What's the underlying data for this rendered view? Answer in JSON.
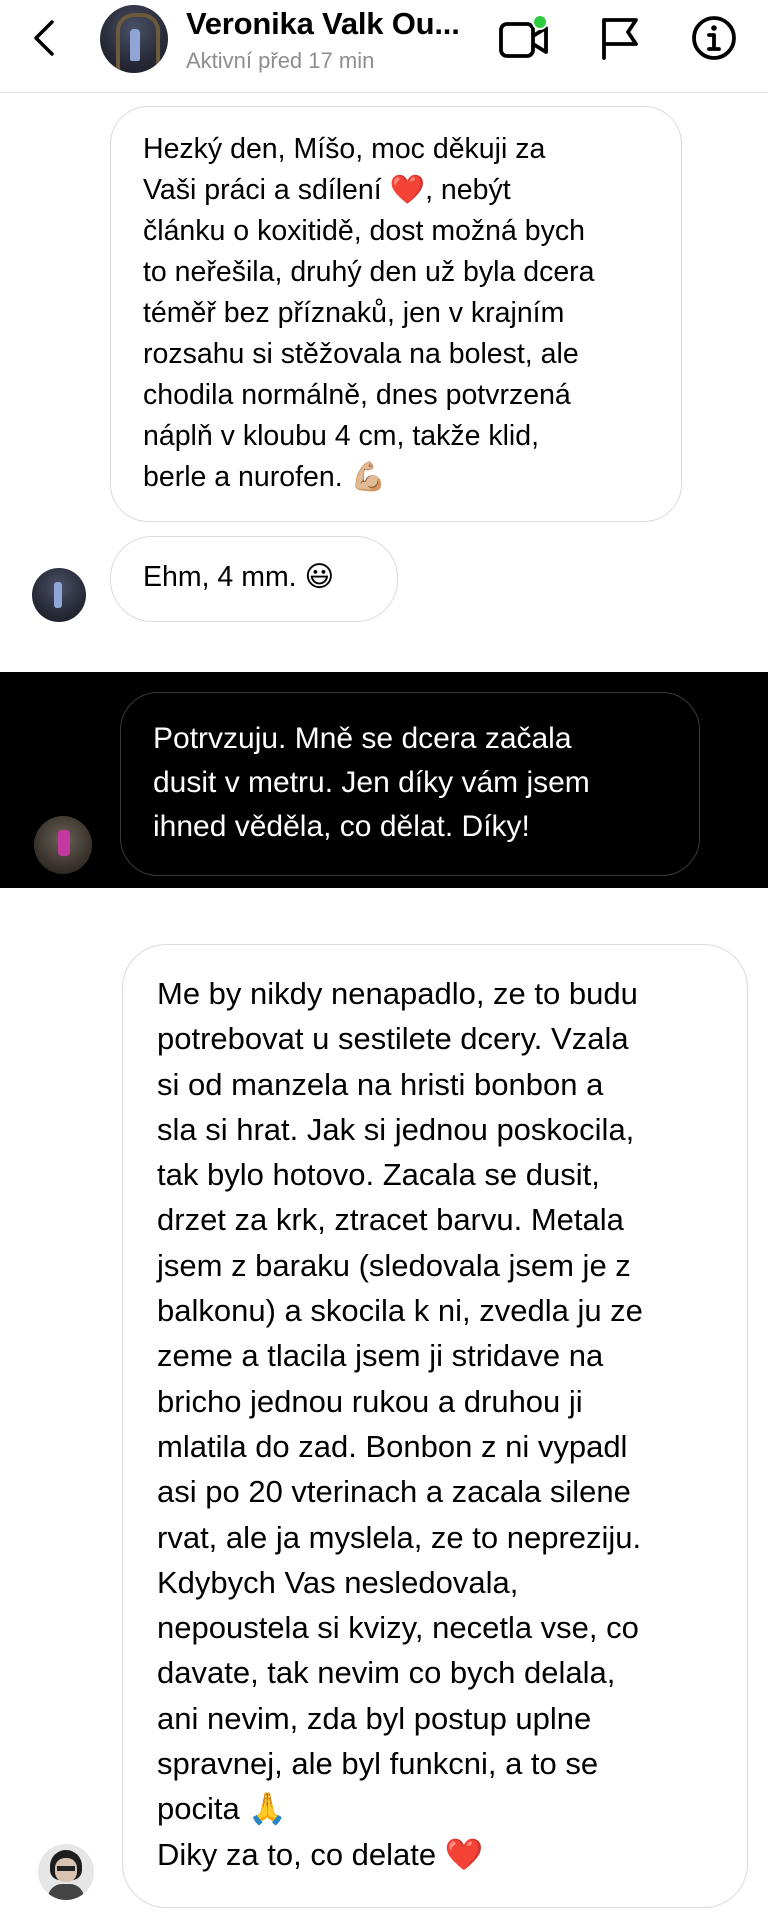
{
  "header": {
    "contact_name": "Veronika Valk Ou...",
    "status": "Aktivní před 17 min",
    "icons": [
      "back-chevron-icon",
      "video-call-icon",
      "flag-icon",
      "info-icon"
    ],
    "online_dot_color": "#2ecc40"
  },
  "messages": [
    {
      "text": "Hezký den, Míšo, moc děkuji za\nVaši práci a sdílení ❤️, nebýt\nčlánku o koxitidě, dost možná bych\nto neřešila, druhý den už byla dcera\ntéměř bez příznaků, jen v krajním\nrozsahu si stěžovala na bolest, ale\nchodila normálně, dnes potvrzená\nnáplň v kloubu 4 cm, takže klid,\nberle a nurofen. 💪🏼"
    },
    {
      "text": "Ehm, 4 mm. 😃"
    },
    {
      "text": "Potrvzuju. Mně se dcera začala\ndusit v metru. Jen díky vám jsem\nihned věděla, co dělat. Díky!"
    },
    {
      "text": "Me by nikdy nenapadlo, ze to budu\npotrebovat u sestilete dcery. Vzala\nsi od manzela na hristi bonbon a\nsla si hrat. Jak si jednou poskocila,\ntak bylo hotovo. Zacala se dusit,\ndrzet za krk, ztracet barvu. Metala\njsem z baraku (sledovala jsem je z\nbalkonu) a skocila k ni, zvedla ju ze\nzeme a tlacila jsem ji stridave na\nbricho jednou rukou a druhou ji\nmlatila do zad. Bonbon z ni vypadl\nasi po 20 vterinach a zacala silene\nrvat, ale ja myslela, ze to nepreziju.\nKdybych Vas nesledovala,\nnepoustela si kvizy, necetla vse, co\ndavate, tak nevim co bych delala,\nani nevim, zda byl postup uplne\nspravnej, ale byl funkcni, a to se\npocita 🙏\nDiky za to, co delate ❤️"
    }
  ],
  "colors": {
    "bubble_border": "#dbdbdb",
    "dark_band": "#000000",
    "status_text": "#8e8e8e"
  }
}
